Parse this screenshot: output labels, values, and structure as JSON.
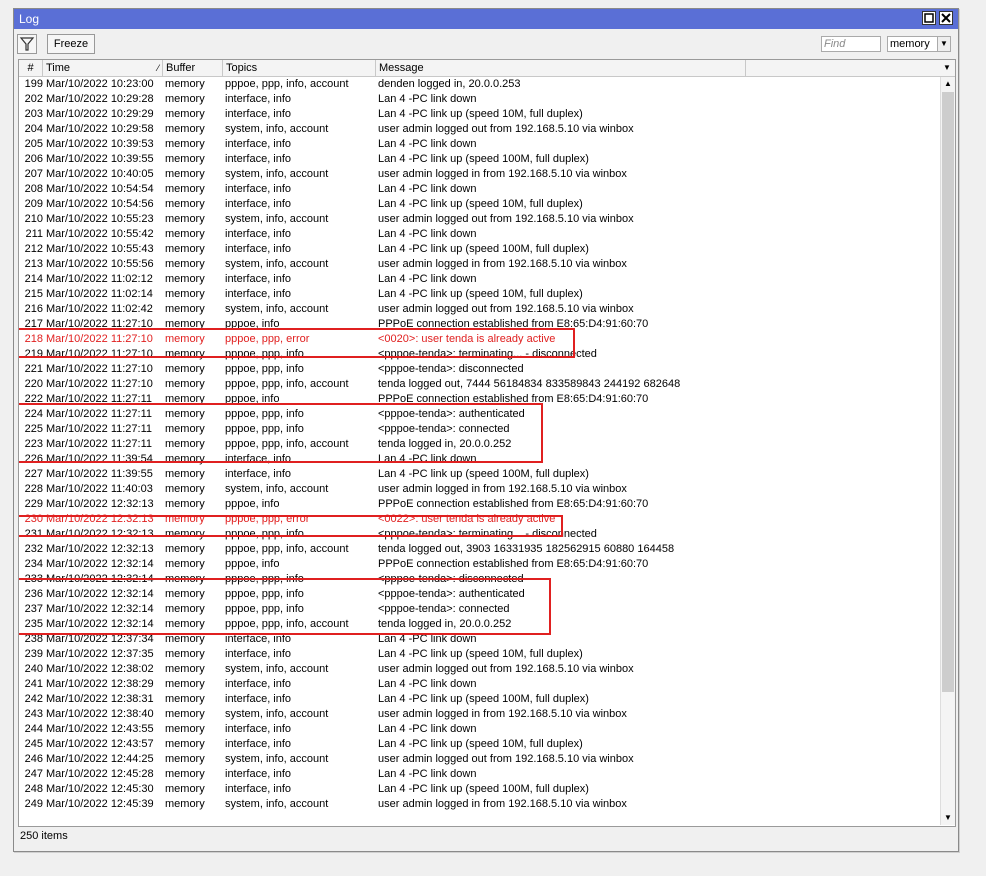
{
  "window": {
    "title": "Log"
  },
  "toolbar": {
    "freeze_label": "Freeze",
    "find_placeholder": "Find",
    "buffer_value": "memory"
  },
  "columns": {
    "num": "#",
    "time": "Time",
    "buffer": "Buffer",
    "topics": "Topics",
    "message": "Message"
  },
  "rows": [
    {
      "num": "199",
      "time": "Mar/10/2022 10:23:00",
      "buffer": "memory",
      "topics": "pppoe, ppp, info, account",
      "message": "denden logged in, 20.0.0.253"
    },
    {
      "num": "202",
      "time": "Mar/10/2022 10:29:28",
      "buffer": "memory",
      "topics": "interface, info",
      "message": "Lan 4 -PC link down"
    },
    {
      "num": "203",
      "time": "Mar/10/2022 10:29:29",
      "buffer": "memory",
      "topics": "interface, info",
      "message": "Lan 4 -PC link up (speed 10M, full duplex)"
    },
    {
      "num": "204",
      "time": "Mar/10/2022 10:29:58",
      "buffer": "memory",
      "topics": "system, info, account",
      "message": "user admin logged out from 192.168.5.10 via winbox"
    },
    {
      "num": "205",
      "time": "Mar/10/2022 10:39:53",
      "buffer": "memory",
      "topics": "interface, info",
      "message": "Lan 4 -PC link down"
    },
    {
      "num": "206",
      "time": "Mar/10/2022 10:39:55",
      "buffer": "memory",
      "topics": "interface, info",
      "message": "Lan 4 -PC link up (speed 100M, full duplex)"
    },
    {
      "num": "207",
      "time": "Mar/10/2022 10:40:05",
      "buffer": "memory",
      "topics": "system, info, account",
      "message": "user admin logged in from 192.168.5.10 via winbox"
    },
    {
      "num": "208",
      "time": "Mar/10/2022 10:54:54",
      "buffer": "memory",
      "topics": "interface, info",
      "message": "Lan 4 -PC link down"
    },
    {
      "num": "209",
      "time": "Mar/10/2022 10:54:56",
      "buffer": "memory",
      "topics": "interface, info",
      "message": "Lan 4 -PC link up (speed 10M, full duplex)"
    },
    {
      "num": "210",
      "time": "Mar/10/2022 10:55:23",
      "buffer": "memory",
      "topics": "system, info, account",
      "message": "user admin logged out from 192.168.5.10 via winbox"
    },
    {
      "num": "211",
      "time": "Mar/10/2022 10:55:42",
      "buffer": "memory",
      "topics": "interface, info",
      "message": "Lan 4 -PC link down"
    },
    {
      "num": "212",
      "time": "Mar/10/2022 10:55:43",
      "buffer": "memory",
      "topics": "interface, info",
      "message": "Lan 4 -PC link up (speed 100M, full duplex)"
    },
    {
      "num": "213",
      "time": "Mar/10/2022 10:55:56",
      "buffer": "memory",
      "topics": "system, info, account",
      "message": "user admin logged in from 192.168.5.10 via winbox"
    },
    {
      "num": "214",
      "time": "Mar/10/2022 11:02:12",
      "buffer": "memory",
      "topics": "interface, info",
      "message": "Lan 4 -PC link down"
    },
    {
      "num": "215",
      "time": "Mar/10/2022 11:02:14",
      "buffer": "memory",
      "topics": "interface, info",
      "message": "Lan 4 -PC link up (speed 10M, full duplex)"
    },
    {
      "num": "216",
      "time": "Mar/10/2022 11:02:42",
      "buffer": "memory",
      "topics": "system, info, account",
      "message": "user admin logged out from 192.168.5.10 via winbox"
    },
    {
      "num": "217",
      "time": "Mar/10/2022 11:27:10",
      "buffer": "memory",
      "topics": "pppoe, info",
      "message": "PPPoE connection established from E8:65:D4:91:60:70"
    },
    {
      "num": "218",
      "time": "Mar/10/2022 11:27:10",
      "buffer": "memory",
      "topics": "pppoe, ppp, error",
      "message": "<0020>: user tenda is already active",
      "error": true
    },
    {
      "num": "219",
      "time": "Mar/10/2022 11:27:10",
      "buffer": "memory",
      "topics": "pppoe, ppp, info",
      "message": "<pppoe-tenda>: terminating... - disconnected"
    },
    {
      "num": "221",
      "time": "Mar/10/2022 11:27:10",
      "buffer": "memory",
      "topics": "pppoe, ppp, info",
      "message": "<pppoe-tenda>: disconnected"
    },
    {
      "num": "220",
      "time": "Mar/10/2022 11:27:10",
      "buffer": "memory",
      "topics": "pppoe, ppp, info, account",
      "message": "tenda logged out, 7444 56184834 833589843 244192 682648"
    },
    {
      "num": "222",
      "time": "Mar/10/2022 11:27:11",
      "buffer": "memory",
      "topics": "pppoe, info",
      "message": "PPPoE connection established from E8:65:D4:91:60:70"
    },
    {
      "num": "224",
      "time": "Mar/10/2022 11:27:11",
      "buffer": "memory",
      "topics": "pppoe, ppp, info",
      "message": "<pppoe-tenda>: authenticated"
    },
    {
      "num": "225",
      "time": "Mar/10/2022 11:27:11",
      "buffer": "memory",
      "topics": "pppoe, ppp, info",
      "message": "<pppoe-tenda>: connected"
    },
    {
      "num": "223",
      "time": "Mar/10/2022 11:27:11",
      "buffer": "memory",
      "topics": "pppoe, ppp, info, account",
      "message": "tenda logged in, 20.0.0.252"
    },
    {
      "num": "226",
      "time": "Mar/10/2022 11:39:54",
      "buffer": "memory",
      "topics": "interface, info",
      "message": "Lan 4 -PC link down"
    },
    {
      "num": "227",
      "time": "Mar/10/2022 11:39:55",
      "buffer": "memory",
      "topics": "interface, info",
      "message": "Lan 4 -PC link up (speed 100M, full duplex)"
    },
    {
      "num": "228",
      "time": "Mar/10/2022 11:40:03",
      "buffer": "memory",
      "topics": "system, info, account",
      "message": "user admin logged in from 192.168.5.10 via winbox"
    },
    {
      "num": "229",
      "time": "Mar/10/2022 12:32:13",
      "buffer": "memory",
      "topics": "pppoe, info",
      "message": "PPPoE connection established from E8:65:D4:91:60:70"
    },
    {
      "num": "230",
      "time": "Mar/10/2022 12:32:13",
      "buffer": "memory",
      "topics": "pppoe, ppp, error",
      "message": "<0022>: user tenda is already active",
      "error": true
    },
    {
      "num": "231",
      "time": "Mar/10/2022 12:32:13",
      "buffer": "memory",
      "topics": "pppoe, ppp, info",
      "message": "<pppoe-tenda>: terminating... - disconnected"
    },
    {
      "num": "232",
      "time": "Mar/10/2022 12:32:13",
      "buffer": "memory",
      "topics": "pppoe, ppp, info, account",
      "message": "tenda logged out, 3903 16331935 182562915 60880 164458"
    },
    {
      "num": "234",
      "time": "Mar/10/2022 12:32:14",
      "buffer": "memory",
      "topics": "pppoe, info",
      "message": "PPPoE connection established from E8:65:D4:91:60:70"
    },
    {
      "num": "233",
      "time": "Mar/10/2022 12:32:14",
      "buffer": "memory",
      "topics": "pppoe, ppp, info",
      "message": "<pppoe-tenda>: disconnected"
    },
    {
      "num": "236",
      "time": "Mar/10/2022 12:32:14",
      "buffer": "memory",
      "topics": "pppoe, ppp, info",
      "message": "<pppoe-tenda>: authenticated"
    },
    {
      "num": "237",
      "time": "Mar/10/2022 12:32:14",
      "buffer": "memory",
      "topics": "pppoe, ppp, info",
      "message": "<pppoe-tenda>: connected"
    },
    {
      "num": "235",
      "time": "Mar/10/2022 12:32:14",
      "buffer": "memory",
      "topics": "pppoe, ppp, info, account",
      "message": "tenda logged in, 20.0.0.252"
    },
    {
      "num": "238",
      "time": "Mar/10/2022 12:37:34",
      "buffer": "memory",
      "topics": "interface, info",
      "message": "Lan 4 -PC link down"
    },
    {
      "num": "239",
      "time": "Mar/10/2022 12:37:35",
      "buffer": "memory",
      "topics": "interface, info",
      "message": "Lan 4 -PC link up (speed 10M, full duplex)"
    },
    {
      "num": "240",
      "time": "Mar/10/2022 12:38:02",
      "buffer": "memory",
      "topics": "system, info, account",
      "message": "user admin logged out from 192.168.5.10 via winbox"
    },
    {
      "num": "241",
      "time": "Mar/10/2022 12:38:29",
      "buffer": "memory",
      "topics": "interface, info",
      "message": "Lan 4 -PC link down"
    },
    {
      "num": "242",
      "time": "Mar/10/2022 12:38:31",
      "buffer": "memory",
      "topics": "interface, info",
      "message": "Lan 4 -PC link up (speed 100M, full duplex)"
    },
    {
      "num": "243",
      "time": "Mar/10/2022 12:38:40",
      "buffer": "memory",
      "topics": "system, info, account",
      "message": "user admin logged in from 192.168.5.10 via winbox"
    },
    {
      "num": "244",
      "time": "Mar/10/2022 12:43:55",
      "buffer": "memory",
      "topics": "interface, info",
      "message": "Lan 4 -PC link down"
    },
    {
      "num": "245",
      "time": "Mar/10/2022 12:43:57",
      "buffer": "memory",
      "topics": "interface, info",
      "message": "Lan 4 -PC link up (speed 10M, full duplex)"
    },
    {
      "num": "246",
      "time": "Mar/10/2022 12:44:25",
      "buffer": "memory",
      "topics": "system, info, account",
      "message": "user admin logged out from 192.168.5.10 via winbox"
    },
    {
      "num": "247",
      "time": "Mar/10/2022 12:45:28",
      "buffer": "memory",
      "topics": "interface, info",
      "message": "Lan 4 -PC link down"
    },
    {
      "num": "248",
      "time": "Mar/10/2022 12:45:30",
      "buffer": "memory",
      "topics": "interface, info",
      "message": "Lan 4 -PC link up (speed 100M, full duplex)"
    },
    {
      "num": "249",
      "time": "Mar/10/2022 12:45:39",
      "buffer": "memory",
      "topics": "system, info, account",
      "message": "user admin logged in from 192.168.5.10 via winbox"
    }
  ],
  "status": {
    "items_label": "250 items"
  },
  "colors": {
    "titlebar": "#5a6fd6",
    "error_text": "#e02020",
    "highlight_box": "#e02020"
  }
}
